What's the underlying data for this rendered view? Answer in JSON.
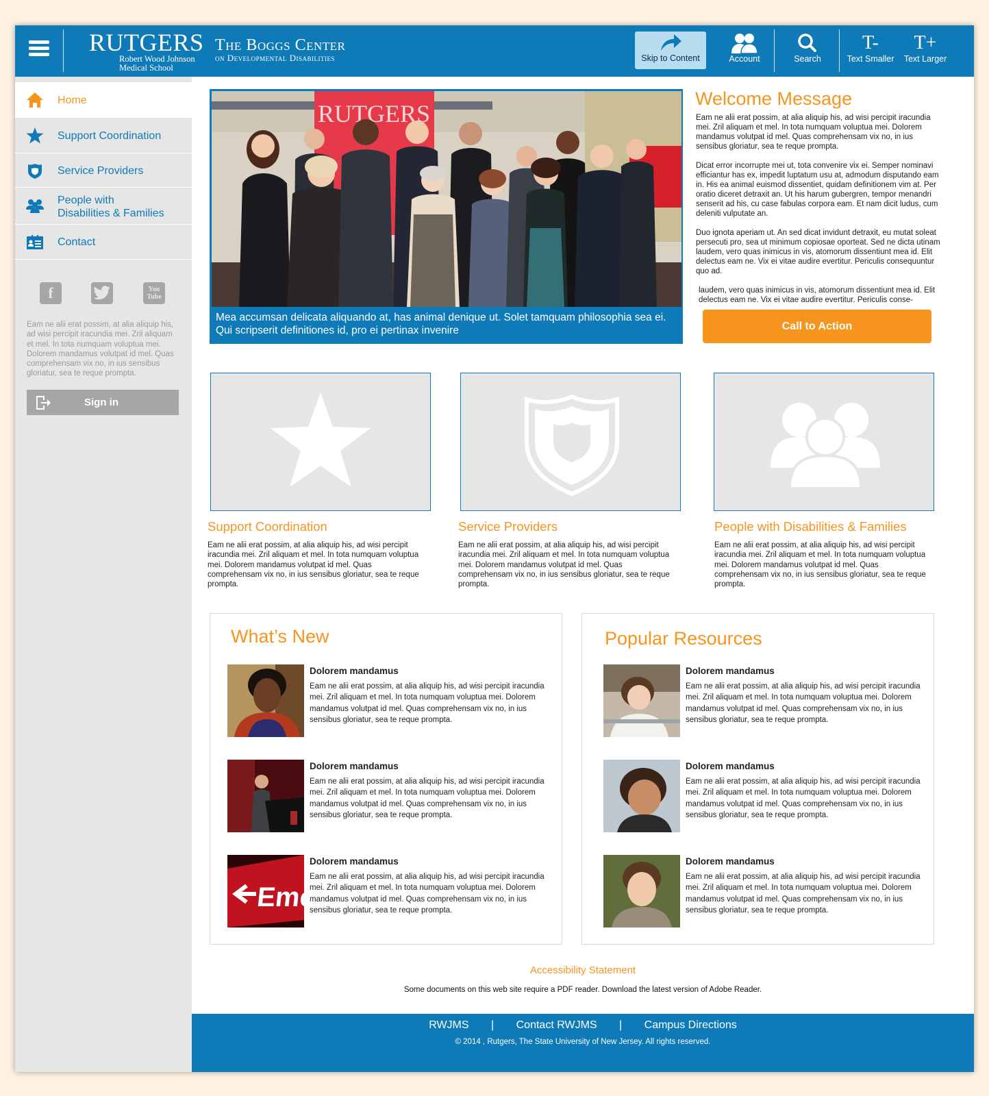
{
  "header": {
    "logo_title": "RUTGERS",
    "logo_sub_1": "Robert Wood Johnson",
    "logo_sub_2": "Medical School",
    "center_line1": "The Boggs Center",
    "center_line2": "on Developmental Disabilities",
    "skip_label": "Skip to Content",
    "account_label": "Account",
    "search_label": "Search",
    "smaller_glyph": "T-",
    "smaller_label": "Text Smaller",
    "larger_glyph": "T+",
    "larger_label": "Text Larger"
  },
  "sidebar": {
    "items": [
      {
        "label": "Home",
        "icon": "home-icon"
      },
      {
        "label": "Support Coordination",
        "icon": "star-icon"
      },
      {
        "label": "Service Providers",
        "icon": "shield-icon"
      },
      {
        "label": "People with",
        "label2": "Disabilities & Families",
        "icon": "people-icon"
      },
      {
        "label": "Contact",
        "icon": "contact-card-icon"
      }
    ],
    "social": {
      "facebook": "f",
      "twitter": "t",
      "youtube": "You Tube"
    },
    "text": "Eam ne alii erat possim, at alia aliquip his, ad wisi percipit iracundia mei. Zril aliquam et mel. In tota numquam voluptua mei. Dolorem mandamus volutpat id mel. Quas comprehensam vix no, in ius sensibus gloriatur, sea te reque prompta.",
    "signin_label": "Sign in"
  },
  "hero": {
    "caption": "Mea accumsan delicata aliquando at, has animal denique ut. Solet tamquam philosophia sea ei. Qui scripserit definitiones id, pro ei pertinax invenire",
    "banner_text": "RUTGERS"
  },
  "welcome": {
    "title": "Welcome Message",
    "p1": "Eam ne alii erat possim, at alia aliquip his, ad wisi percipit iracundia mei. Zril aliquam et mel. In tota numquam voluptua mei. Dolorem mandamus volutpat id mel. Quas comprehensam vix no, in ius sensibus gloriatur, sea te reque prompta.",
    "p2": "Dicat error incorrupte mei ut, tota convenire vix ei. Semper nominavi efficiantur has ex, impedit luptatum usu at, admodum disputando eam in. His ea animal euismod dissentiet, quidam definitionem vim at. Per oratio diceret detraxit an. Ut his harum gubergren, tempor menandri senserit ad his, cu case fabulas corpora eam. Et nam dicit ludus, cum deleniti vulputate an.",
    "p3": "Duo ignota aperiam ut. An sed dicat invidunt detraxit, eu mutat soleat persecuti pro, sea ut minimum copiosae oporteat. Sed ne dicta utinam laudem, vero quas inimicus in vis, atomorum dissentiunt mea id. Elit delectus eam ne. Vix ei vitae audire evertitur. Periculis consequuntur quo ad.",
    "p4": "laudem, vero quas inimicus in vis, atomorum dissentiunt mea id. Elit delectus eam ne. Vix ei vitae audire evertitur. Periculis conse-",
    "cta_label": "Call to Action"
  },
  "cards": [
    {
      "title": "Support Coordination",
      "icon": "star-icon",
      "text": "Eam ne alii erat possim, at alia aliquip his, ad wisi percipit iracundia mei. Zril aliquam et mel. In tota numquam voluptua mei. Dolorem mandamus volutpat id mel. Quas comprehensam vix no, in ius sensibus gloriatur, sea te reque prompta."
    },
    {
      "title": "Service Providers",
      "icon": "shield-icon",
      "text": "Eam ne alii erat possim, at alia aliquip his, ad wisi percipit iracundia mei. Zril aliquam et mel. In tota numquam voluptua mei. Dolorem mandamus volutpat id mel. Quas comprehensam vix no, in ius sensibus gloriatur, sea te reque prompta."
    },
    {
      "title": "People with Disabilities & Families",
      "icon": "people-icon",
      "text": "Eam ne alii erat possim, at alia aliquip his, ad wisi percipit iracundia mei. Zril aliquam et mel. In tota numquam voluptua mei. Dolorem mandamus volutpat id mel. Quas comprehensam vix no, in ius sensibus gloriatur, sea te reque prompta."
    }
  ],
  "whats_new": {
    "title": "What’s New",
    "items": [
      {
        "title": "Dolorem mandamus",
        "text": "Eam ne alii erat possim, at alia aliquip his, ad wisi percipit iracundia mei. Zril aliquam et mel. In tota numquam voluptua mei. Dolorem mandamus volutpat id mel. Quas comprehensam vix no, in ius sensibus gloriatur, sea te reque prompta."
      },
      {
        "title": "Dolorem mandamus",
        "text": "Eam ne alii erat possim, at alia aliquip his, ad wisi percipit iracundia mei. Zril aliquam et mel. In tota numquam voluptua mei. Dolorem mandamus volutpat id mel. Quas comprehensam vix no, in ius sensibus gloriatur, sea te reque prompta."
      },
      {
        "title": "Dolorem mandamus",
        "text": "Eam ne alii erat possim, at alia aliquip his, ad wisi percipit iracundia mei. Zril aliquam et mel. In tota numquam voluptua mei. Dolorem mandamus volutpat id mel. Quas comprehensam vix no, in ius sensibus gloriatur, sea te reque prompta.",
        "sign_text": "Emerg"
      }
    ]
  },
  "popular": {
    "title": "Popular Resources",
    "items": [
      {
        "title": "Dolorem mandamus",
        "text": "Eam ne alii erat possim, at alia aliquip his, ad wisi percipit iracundia mei. Zril aliquam et mel. In tota numquam voluptua mei. Dolorem mandamus volutpat id mel. Quas comprehensam vix no, in ius sensibus gloriatur, sea te reque prompta."
      },
      {
        "title": "Dolorem mandamus",
        "text": "Eam ne alii erat possim, at alia aliquip his, ad wisi percipit iracundia mei. Zril aliquam et mel. In tota numquam voluptua mei. Dolorem mandamus volutpat id mel. Quas comprehensam vix no, in ius sensibus gloriatur, sea te reque prompta."
      },
      {
        "title": "Dolorem mandamus",
        "text": "Eam ne alii erat possim, at alia aliquip his, ad wisi percipit iracundia mei. Zril aliquam et mel. In tota numquam voluptua mei. Dolorem mandamus volutpat id mel. Quas comprehensam vix no, in ius sensibus gloriatur, sea te reque prompta."
      }
    ]
  },
  "footer": {
    "accessibility": "Accessibility Statement",
    "pdf_note": "Some documents on this web site require a PDF reader. Download the latest version of Adobe Reader.",
    "links": [
      "RWJMS",
      "Contact RWJMS",
      "Campus Directions"
    ],
    "separator": "|",
    "copyright": "© 2014 , Rutgers, The State University of New Jersey. All rights reserved."
  },
  "colors": {
    "brand_blue": "#0f7ab8",
    "accent_orange": "#f7941d",
    "sidebar_gray": "#e6e6e6",
    "page_bg": "#fdf1e2"
  }
}
